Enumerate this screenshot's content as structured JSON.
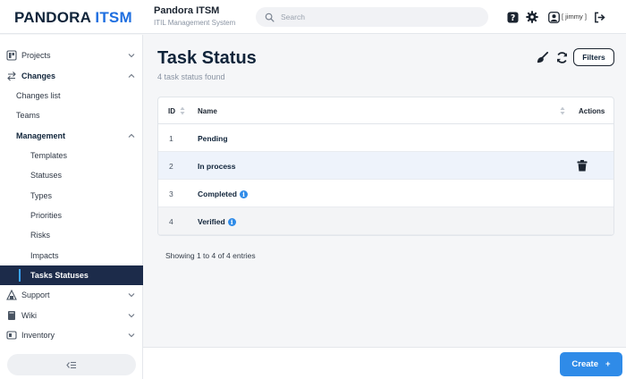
{
  "header": {
    "logo_primary": "PANDORA",
    "logo_secondary": "ITSM",
    "app_title": "Pandora ITSM",
    "app_subtitle": "ITIL Management System",
    "search_placeholder": "Search",
    "user_label": "[ jimmy ]",
    "icons": [
      "help-icon",
      "settings-icon",
      "user-icon",
      "logout-icon"
    ]
  },
  "sidebar": {
    "items": [
      {
        "label": "Projects",
        "icon": "projects-icon",
        "expanded": false
      },
      {
        "label": "Changes",
        "icon": "changes-icon",
        "expanded": true
      },
      {
        "label": "Changes list"
      },
      {
        "label": "Teams"
      },
      {
        "label": "Management",
        "expanded": true
      },
      {
        "label": "Templates"
      },
      {
        "label": "Statuses"
      },
      {
        "label": "Types"
      },
      {
        "label": "Priorities"
      },
      {
        "label": "Risks"
      },
      {
        "label": "Impacts"
      },
      {
        "label": "Tasks Statuses",
        "active": true
      },
      {
        "label": "Support",
        "icon": "support-icon",
        "expanded": false
      },
      {
        "label": "Wiki",
        "icon": "wiki-icon",
        "expanded": false
      },
      {
        "label": "Inventory",
        "icon": "inventory-icon",
        "expanded": false
      }
    ]
  },
  "main": {
    "title": "Task Status",
    "subtitle": "4 task status found",
    "filters_label": "Filters",
    "table": {
      "columns": [
        "ID",
        "Name",
        "Actions"
      ],
      "rows": [
        {
          "id": "1",
          "name": "Pending",
          "info": false,
          "delete": false
        },
        {
          "id": "2",
          "name": "In process",
          "info": false,
          "delete": true
        },
        {
          "id": "3",
          "name": "Completed",
          "info": true,
          "delete": false
        },
        {
          "id": "4",
          "name": "Verified",
          "info": true,
          "delete": false
        }
      ]
    },
    "showing": "Showing 1 to 4 of 4 entries"
  },
  "footer": {
    "create_label": "Create",
    "create_plus": "+"
  },
  "colors": {
    "accent": "#2f8be8",
    "active_nav": "#1c2b4a",
    "brand_blue": "#1f6fe0"
  }
}
